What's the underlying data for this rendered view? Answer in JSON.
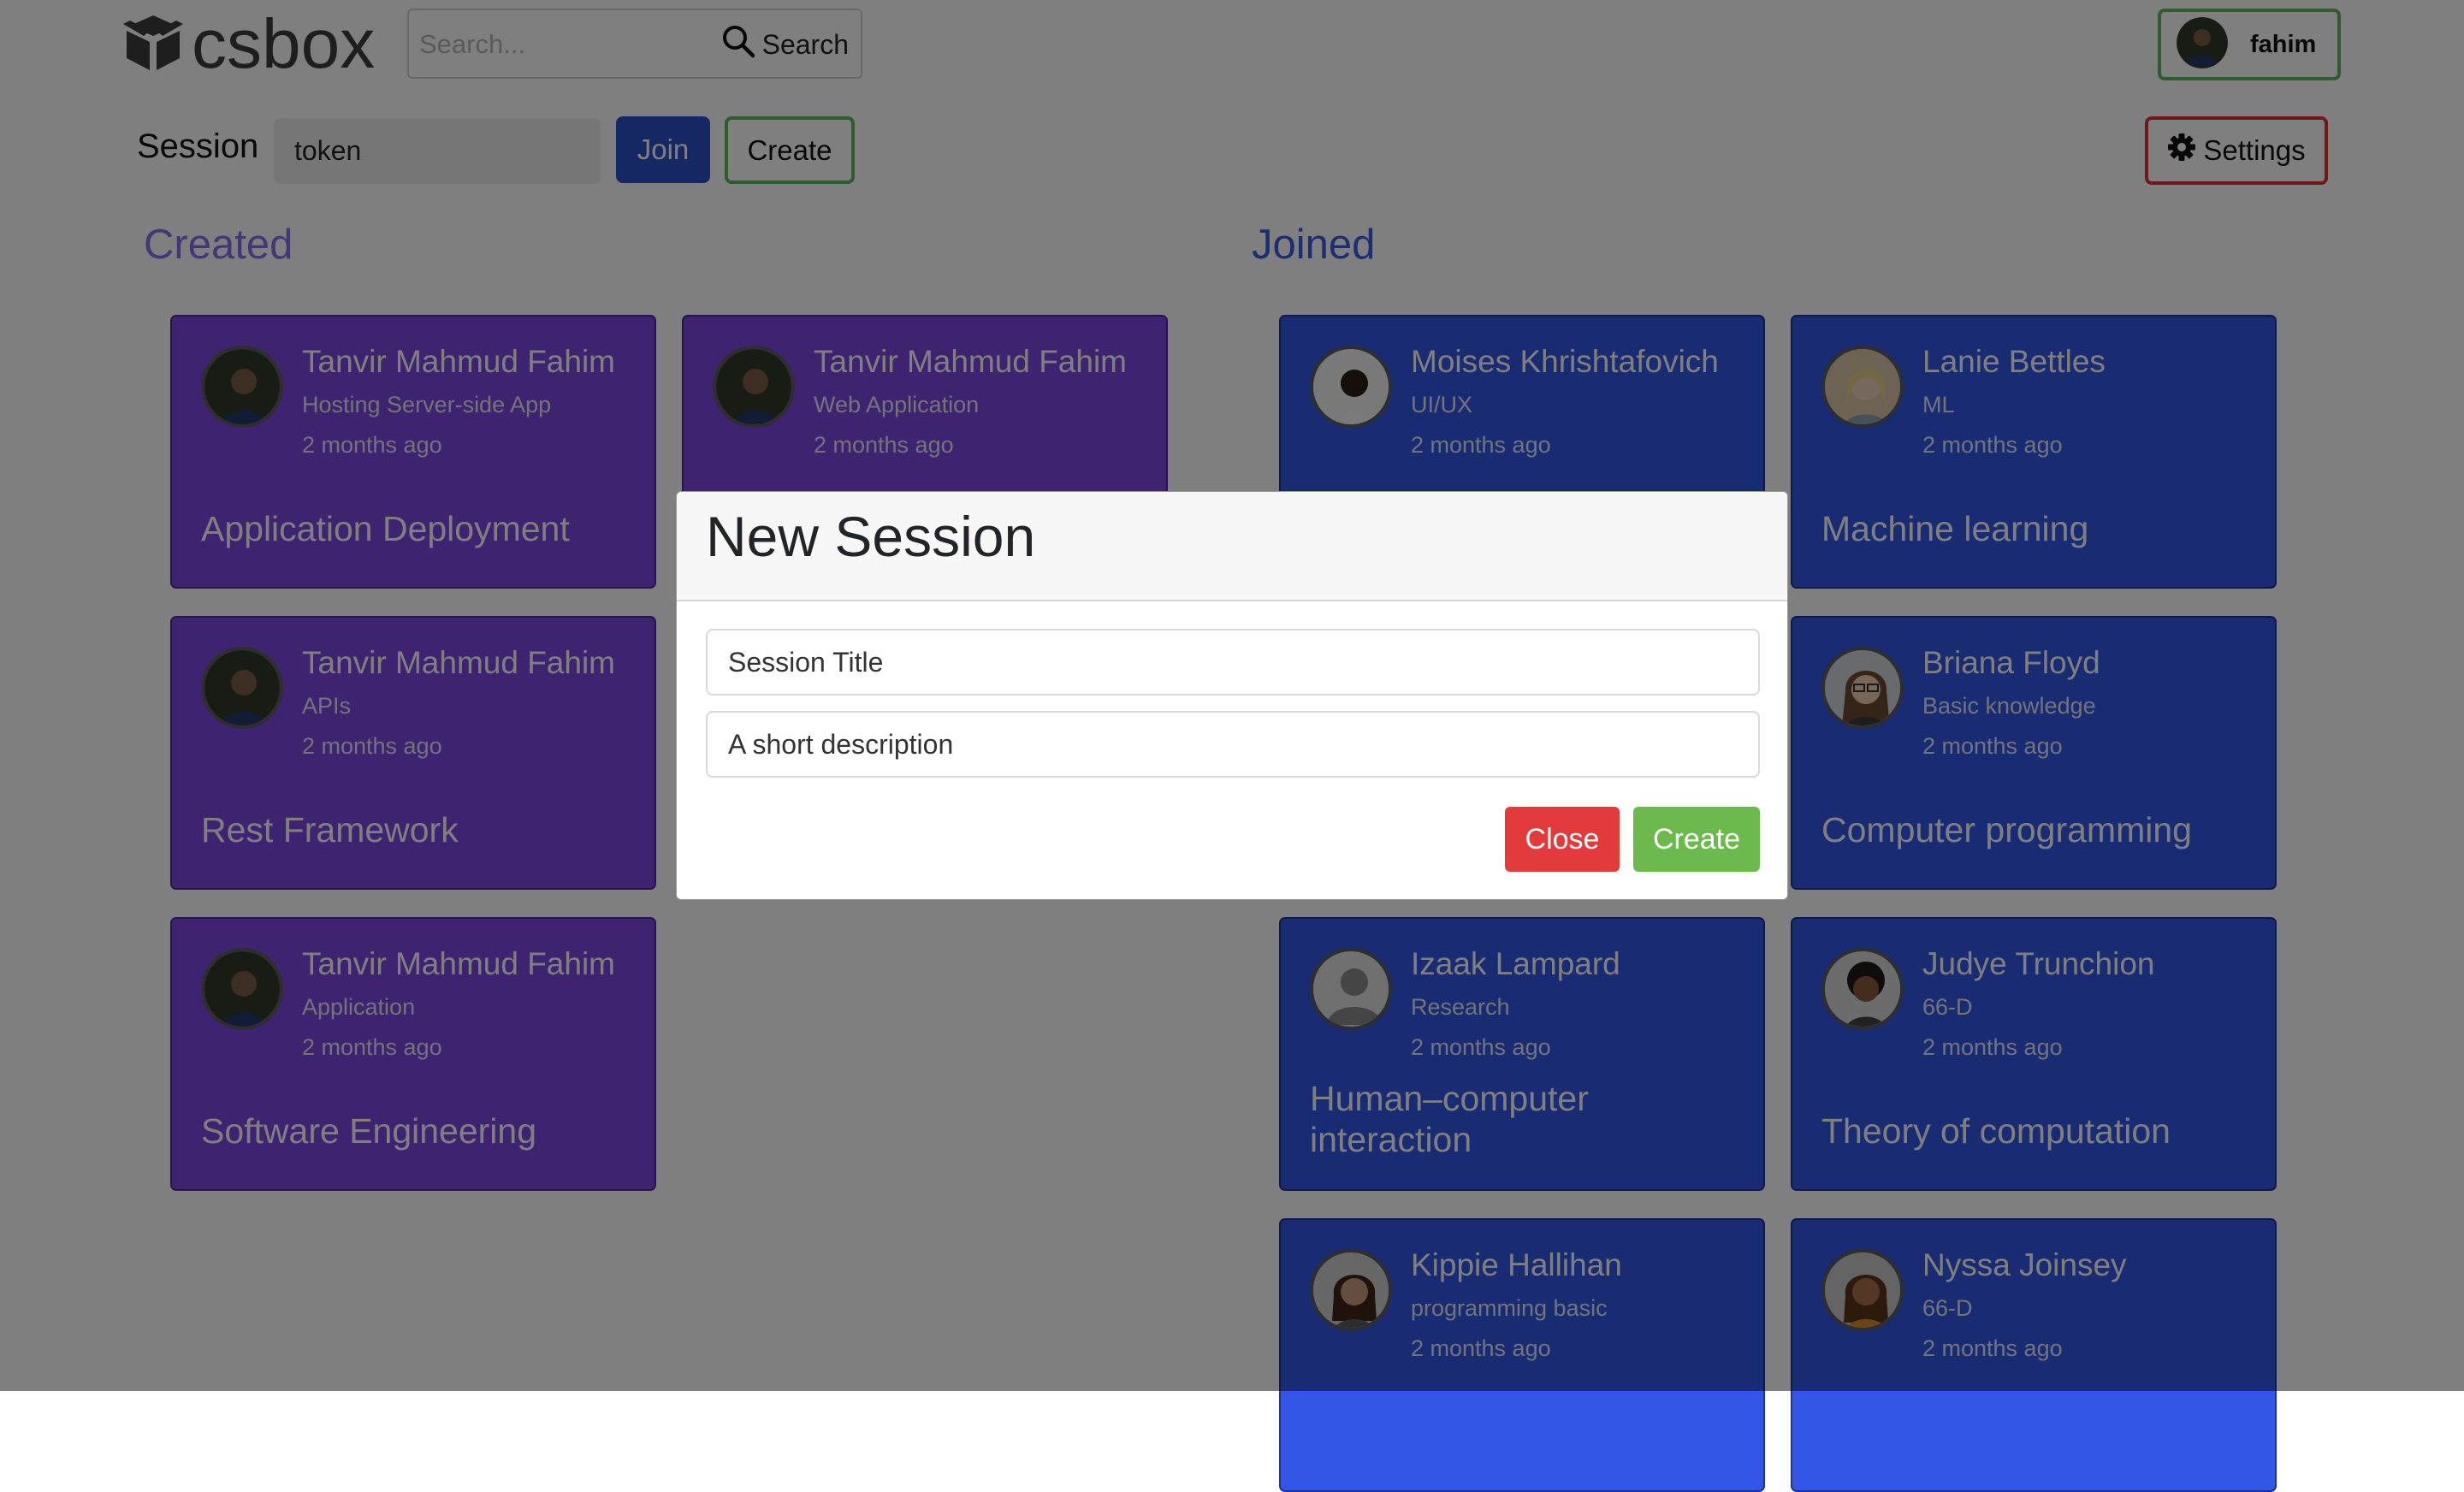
{
  "navbar": {
    "brand": "csbox",
    "search_placeholder": "Search...",
    "search_label": "Search",
    "user_name": "fahim"
  },
  "session_bar": {
    "label": "Session",
    "token_value": "token",
    "join_label": "Join",
    "create_label": "Create",
    "settings_label": "Settings"
  },
  "sections": {
    "created_title": "Created",
    "joined_title": "Joined"
  },
  "created_cards": [
    {
      "name": "Tanvir Mahmud Fahim",
      "desc": "Hosting Server-side App",
      "time": "2 months ago",
      "title": "Application Deployment"
    },
    {
      "name": "Tanvir Mahmud Fahim",
      "desc": "Web Application",
      "time": "2 months ago",
      "title": ""
    },
    {
      "name": "Tanvir Mahmud Fahim",
      "desc": "APIs",
      "time": "2 months ago",
      "title": "Rest Framework"
    },
    {
      "name": "Tanvir Mahmud Fahim",
      "desc": "Application",
      "time": "2 months ago",
      "title": "Software Engineering"
    }
  ],
  "joined_cards": [
    {
      "name": "Moises Khrishtafovich",
      "desc": "UI/UX",
      "time": "2 months ago",
      "title": ""
    },
    {
      "name": "Lanie Bettles",
      "desc": "ML",
      "time": "2 months ago",
      "title": "Machine learning"
    },
    {
      "name": "Briana Floyd",
      "desc": "Basic knowledge",
      "time": "2 months ago",
      "title": "Computer programming"
    },
    {
      "name": "Izaak Lampard",
      "desc": "Research",
      "time": "2 months ago",
      "title": "Human–computer interaction"
    },
    {
      "name": "Judye Trunchion",
      "desc": "66-D",
      "time": "2 months ago",
      "title": "Theory of computation"
    },
    {
      "name": "Kippie Hallihan",
      "desc": "programming basic",
      "time": "2 months ago",
      "title": ""
    },
    {
      "name": "Nyssa Joinsey",
      "desc": "66-D",
      "time": "2 months ago",
      "title": ""
    }
  ],
  "modal": {
    "title": "New Session",
    "title_placeholder": "Session Title",
    "description_placeholder": "A short description",
    "close_label": "Close",
    "create_label": "Create"
  },
  "colors": {
    "created_card": "#7b47e0",
    "joined_card": "#3356e6",
    "created_heading": "#8a6cf0",
    "joined_heading": "#3a5ae8",
    "accent_green": "#5cb85c",
    "accent_red": "#e03030"
  },
  "icons": {
    "logo": "box-icon",
    "search": "search-icon",
    "settings": "gear-icon"
  }
}
